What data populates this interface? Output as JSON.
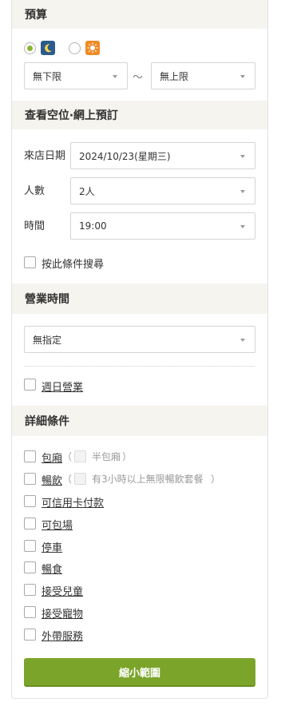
{
  "budget": {
    "title": "預算",
    "min_value": "無下限",
    "separator": "～",
    "max_value": "無上限"
  },
  "availability": {
    "title": "查看空位‧網上預訂",
    "date_label": "來店日期",
    "date_value": "2024/10/23(星期三)",
    "people_label": "人數",
    "people_value": "2人",
    "time_label": "時間",
    "time_value": "19:00",
    "search_condition_label": "按此條件搜尋"
  },
  "hours": {
    "title": "營業時間",
    "value": "無指定",
    "sunday_label": "週日營業"
  },
  "details": {
    "title": "詳細條件",
    "private_room": "包廂",
    "semi_private": "半包廂",
    "drinks": "暢飲",
    "drinks_3h": "有3小時以上無限暢飲套餐",
    "paren_open": "（",
    "paren_close": "）",
    "items": [
      "可信用卡付款",
      "可包場",
      "停車",
      "暢食",
      "接受兒童",
      "接受寵物",
      "外帶服務"
    ]
  },
  "submit_label": "縮小範圍",
  "colors": {
    "accent": "#7ba42a",
    "header_bg": "#f6f4ef",
    "night_icon": "#2c5a8c",
    "day_icon": "#f08a24"
  },
  "icons": {
    "night": "moon-icon",
    "day": "sun-icon"
  }
}
